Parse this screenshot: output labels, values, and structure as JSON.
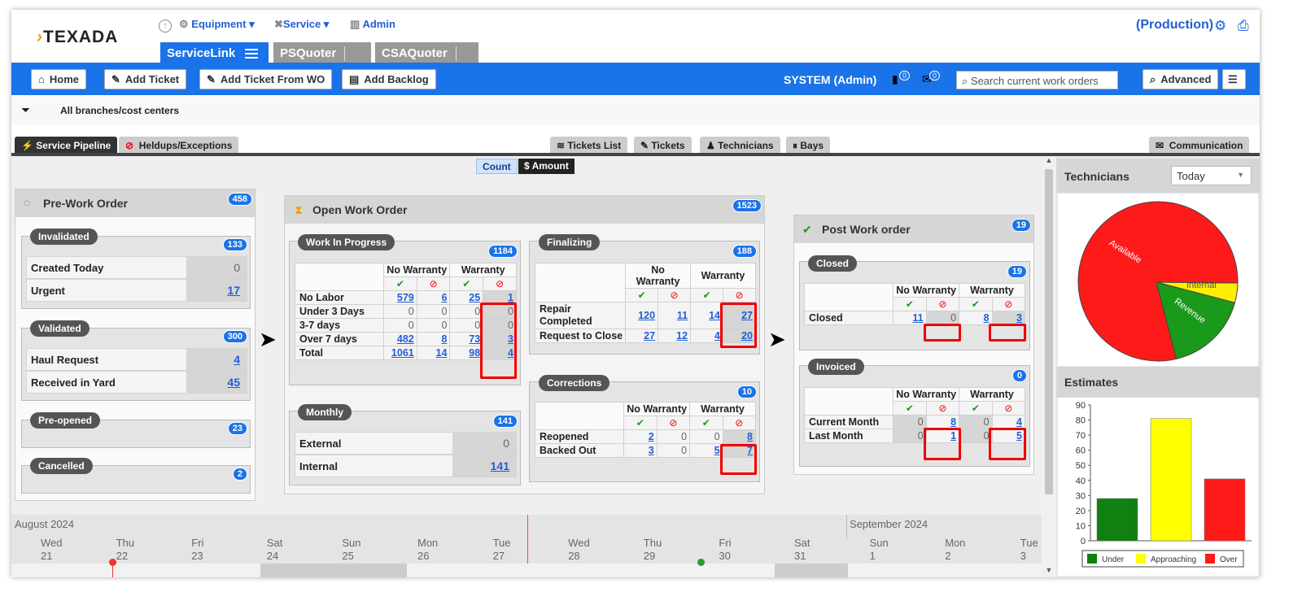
{
  "app": {
    "logo": "TEXADA",
    "env": "(Production)"
  },
  "topnav": {
    "equipment": "Equipment",
    "service": "Service",
    "admin": "Admin"
  },
  "apptabs": [
    {
      "label": "ServiceLink"
    },
    {
      "label": "PSQuoter"
    },
    {
      "label": "CSAQuoter"
    }
  ],
  "toolbar": {
    "home": "Home",
    "add_ticket": "Add Ticket",
    "add_ticket_wo": "Add Ticket From WO",
    "add_backlog": "Add Backlog",
    "user": "SYSTEM (Admin)",
    "badge1": "0",
    "badge2": "0",
    "search_placeholder": "Search current work orders",
    "advanced": "Advanced"
  },
  "filter": {
    "label": "All branches/cost centers"
  },
  "subtabs": {
    "pipeline": "Service Pipeline",
    "heldups": "Heldups/Exceptions",
    "tickets_list": "Tickets List",
    "tickets": "Tickets",
    "technicians": "Technicians",
    "bays": "Bays",
    "communication": "Communication"
  },
  "toggle": {
    "count": "Count",
    "amount": "$ Amount"
  },
  "pre": {
    "title": "Pre-Work Order",
    "count": "458",
    "invalidated": {
      "label": "Invalidated",
      "count": "133",
      "rows": [
        {
          "label": "Created Today",
          "value": "0"
        },
        {
          "label": "Urgent",
          "value": "17"
        }
      ]
    },
    "validated": {
      "label": "Validated",
      "count": "300",
      "rows": [
        {
          "label": "Haul Request",
          "value": "4"
        },
        {
          "label": "Received in Yard",
          "value": "45"
        }
      ]
    },
    "preopened": {
      "label": "Pre-opened",
      "count": "23"
    },
    "cancelled": {
      "label": "Cancelled",
      "count": "2"
    }
  },
  "open": {
    "title": "Open Work Order",
    "count": "1523",
    "hdr": {
      "nowarranty": "No Warranty",
      "warranty": "Warranty"
    },
    "wip": {
      "label": "Work In Progress",
      "count": "1184",
      "rows": [
        {
          "label": "No Labor",
          "v": [
            "579",
            "6",
            "25",
            "1"
          ]
        },
        {
          "label": "Under 3 Days",
          "v": [
            "0",
            "0",
            "0",
            "0"
          ]
        },
        {
          "label": "3-7 days",
          "v": [
            "0",
            "0",
            "0",
            "0"
          ]
        },
        {
          "label": "Over 7 days",
          "v": [
            "482",
            "8",
            "73",
            "3"
          ]
        },
        {
          "label": "Total",
          "v": [
            "1061",
            "14",
            "98",
            "4"
          ]
        }
      ]
    },
    "monthly": {
      "label": "Monthly",
      "count": "141",
      "rows": [
        {
          "label": "External",
          "value": "0"
        },
        {
          "label": "Internal",
          "value": "141"
        }
      ]
    },
    "finalizing": {
      "label": "Finalizing",
      "count": "188",
      "rows": [
        {
          "label": "Repair Completed",
          "v": [
            "120",
            "11",
            "14",
            "27"
          ]
        },
        {
          "label": "Request to Close",
          "v": [
            "27",
            "12",
            "4",
            "20"
          ]
        }
      ]
    },
    "corrections": {
      "label": "Corrections",
      "count": "10",
      "rows": [
        {
          "label": "Reopened",
          "v": [
            "2",
            "0",
            "0",
            "8"
          ]
        },
        {
          "label": "Backed Out",
          "v": [
            "3",
            "0",
            "5",
            "7"
          ]
        }
      ]
    }
  },
  "post": {
    "title": "Post Work order",
    "count": "19",
    "closed": {
      "label": "Closed",
      "count": "19",
      "rows": [
        {
          "label": "Closed",
          "v": [
            "11",
            "0",
            "8",
            "3"
          ]
        }
      ]
    },
    "invoiced": {
      "label": "Invoiced",
      "count": "0",
      "rows": [
        {
          "label": "Current Month",
          "v": [
            "0",
            "8",
            "0",
            "4"
          ]
        },
        {
          "label": "Last Month",
          "v": [
            "0",
            "1",
            "0",
            "5"
          ]
        }
      ]
    }
  },
  "timeline": {
    "months": [
      "August 2024",
      "September 2024"
    ],
    "days": [
      {
        "dow": "Wed",
        "d": "21"
      },
      {
        "dow": "Thu",
        "d": "22"
      },
      {
        "dow": "Fri",
        "d": "23"
      },
      {
        "dow": "Sat",
        "d": "24"
      },
      {
        "dow": "Sun",
        "d": "25"
      },
      {
        "dow": "Mon",
        "d": "26"
      },
      {
        "dow": "Tue",
        "d": "27"
      },
      {
        "dow": "Wed",
        "d": "28"
      },
      {
        "dow": "Thu",
        "d": "29"
      },
      {
        "dow": "Fri",
        "d": "30"
      },
      {
        "dow": "Sat",
        "d": "31"
      },
      {
        "dow": "Sun",
        "d": "1"
      },
      {
        "dow": "Mon",
        "d": "2"
      },
      {
        "dow": "Tue",
        "d": "3"
      }
    ]
  },
  "technicians": {
    "title": "Technicians",
    "period": "Today"
  },
  "estimates": {
    "title": "Estimates"
  },
  "chart_data": [
    {
      "type": "pie",
      "title": "",
      "labels": [
        "Available",
        "Internal",
        "Revenue"
      ],
      "values": [
        79,
        4,
        17
      ],
      "colors": [
        "#ff1a1a",
        "#ffee00",
        "#1a9a1a"
      ]
    },
    {
      "type": "bar",
      "title": "",
      "categories": [
        "Under",
        "Approaching",
        "Over"
      ],
      "values": [
        28,
        81,
        41
      ],
      "colors": [
        "#108010",
        "#ffff00",
        "#ff1a1a"
      ],
      "ylim": [
        0,
        90
      ],
      "yticks": [
        0,
        10,
        20,
        30,
        40,
        50,
        60,
        70,
        80,
        90
      ],
      "legend": "bottom"
    }
  ]
}
